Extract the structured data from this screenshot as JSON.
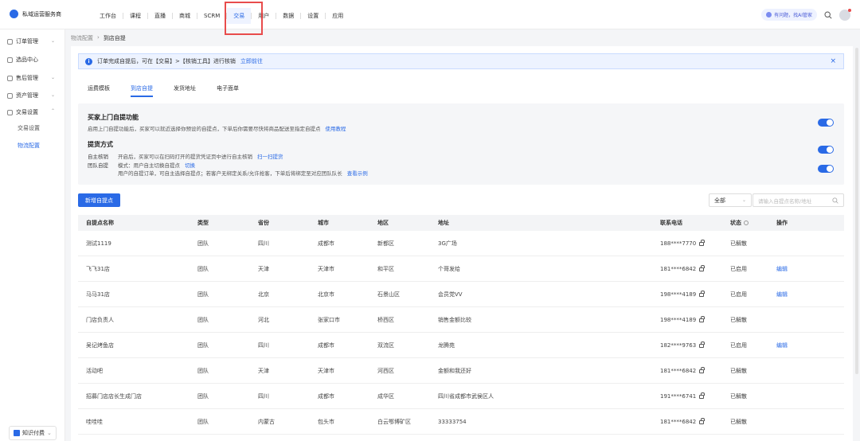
{
  "brand": {
    "name": "私域运营服务商"
  },
  "nav": {
    "items": [
      {
        "label": "工作台"
      },
      {
        "label": "课程"
      },
      {
        "label": "直播"
      },
      {
        "label": "商城"
      },
      {
        "label": "SCRM"
      },
      {
        "label": "交易"
      },
      {
        "label": "用户"
      },
      {
        "label": "数据"
      },
      {
        "label": "设置"
      },
      {
        "label": "应用"
      }
    ],
    "active_index": 5
  },
  "topright": {
    "ai_label": "有问题，找AI管家"
  },
  "sidebar": {
    "items": [
      {
        "label": "订单管理",
        "has_chevron": true
      },
      {
        "label": "选品中心",
        "has_chevron": false
      },
      {
        "label": "售后管理",
        "has_chevron": true
      },
      {
        "label": "资产管理",
        "has_chevron": true
      },
      {
        "label": "交易设置",
        "has_chevron": true
      }
    ],
    "subitems": [
      {
        "label": "交易设置",
        "active": false
      },
      {
        "label": "物流配置",
        "active": true
      }
    ],
    "footer_label": "知识付费"
  },
  "breadcrumb": {
    "parent": "物流配置",
    "separator": "›",
    "current": "到店自提"
  },
  "notice": {
    "text": "订单完成自提后，可在【交易】>【核销工具】进行核销",
    "link": "立即前往",
    "close": "×"
  },
  "tabs": [
    {
      "label": "运费模板",
      "active": false
    },
    {
      "label": "到店自提",
      "active": true
    },
    {
      "label": "发货地址",
      "active": false
    },
    {
      "label": "电子面单",
      "active": false
    }
  ],
  "settings": {
    "buyer_pickup": {
      "title": "买家上门自提功能",
      "desc": "启用上门自提功能后，买家可以就近选择你预设的自提点，下单后你需要尽快将商品配送至指定自提点",
      "link": "使用教程",
      "enabled": true
    },
    "pickup_method": {
      "title": "提货方式",
      "self_verify": {
        "label": "自主核销",
        "desc": "开启后，买家可以在扫码打开的提货凭证页中进行自主核销",
        "link": "扫一扫提货",
        "enabled": true
      },
      "group_pickup": {
        "label": "团队自提",
        "mode_text": "模式：用户自主切换自提点",
        "mode_link": "切换",
        "desc": "用户的自提订单，可自主选择自提点；若客户无绑定关系/允许抢客，下单后将绑定至对应团队队长",
        "link": "查看示例",
        "enabled": true
      }
    }
  },
  "toolbar": {
    "add_button": "新增自提点",
    "filter_value": "全部",
    "search_placeholder": "请输入自提点名称/地址"
  },
  "table": {
    "headers": [
      "自提点名称",
      "类型",
      "省份",
      "城市",
      "地区",
      "地址",
      "联系电话",
      "状态",
      "操作"
    ],
    "rows": [
      {
        "name": "测试1119",
        "type": "团队",
        "province": "四川",
        "city": "成都市",
        "district": "新都区",
        "address": "3G广场",
        "phone": "188****7770",
        "status": "已解散",
        "action": ""
      },
      {
        "name": "飞飞31店",
        "type": "团队",
        "province": "天津",
        "city": "天津市",
        "district": "和平区",
        "address": "个哥发给",
        "phone": "181****6842",
        "status": "已启用",
        "action": "编辑"
      },
      {
        "name": "马马31店",
        "type": "团队",
        "province": "北京",
        "city": "北京市",
        "district": "石景山区",
        "address": "会员党VV",
        "phone": "198****4189",
        "status": "已启用",
        "action": "编辑"
      },
      {
        "name": "门店负责人",
        "type": "团队",
        "province": "河北",
        "city": "张家口市",
        "district": "桥西区",
        "address": "销售金额比较",
        "phone": "198****4189",
        "status": "已解散",
        "action": ""
      },
      {
        "name": "吴记烤鱼店",
        "type": "团队",
        "province": "四川",
        "city": "成都市",
        "district": "双流区",
        "address": "龙腾苑",
        "phone": "182****9763",
        "status": "已启用",
        "action": "编辑"
      },
      {
        "name": "活动吧",
        "type": "团队",
        "province": "天津",
        "city": "天津市",
        "district": "河西区",
        "address": "金额和我还好",
        "phone": "181****6842",
        "status": "已解散",
        "action": ""
      },
      {
        "name": "招募门店店长生成门店",
        "type": "团队",
        "province": "四川",
        "city": "成都市",
        "district": "成华区",
        "address": "四川省成都市武侯区人",
        "phone": "191****6741",
        "status": "已解散",
        "action": ""
      },
      {
        "name": "哇哇哇",
        "type": "团队",
        "province": "内蒙古",
        "city": "包头市",
        "district": "白云鄂博矿区",
        "address": "33333754",
        "phone": "181****6842",
        "status": "已解散",
        "action": ""
      }
    ]
  },
  "colors": {
    "accent": "#2a6ae6",
    "highlight_box": "#e84c4c",
    "notice_bg": "#edf3ff"
  }
}
